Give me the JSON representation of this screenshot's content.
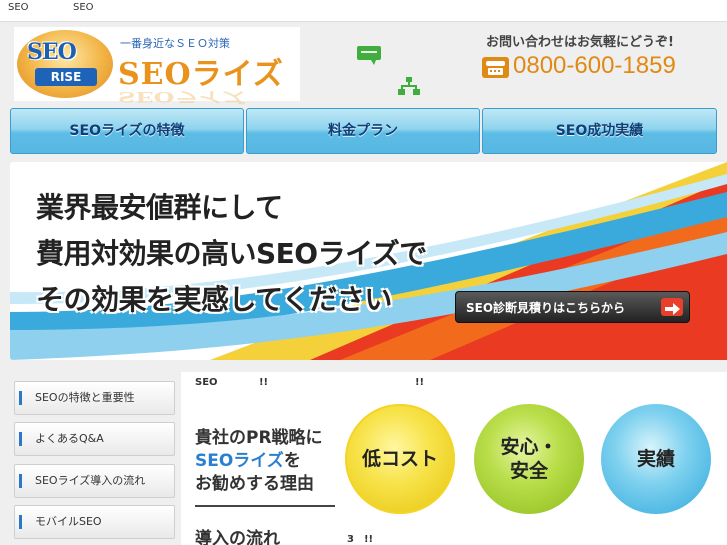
{
  "topbar": {
    "left_text": "SEO",
    "right_text": "SEO"
  },
  "logo": {
    "badge_top": "SEO",
    "badge_bottom": "RISE",
    "tagline": "一番身近なＳＥＯ対策",
    "name": "SEOライズ"
  },
  "contact": {
    "label": "お問い合わせはお気軽にどうぞ!",
    "phone": "0800-600-1859"
  },
  "nav": {
    "items": [
      {
        "label": "SEOライズの特徴"
      },
      {
        "label": "料金プラン"
      },
      {
        "label": "SEO成功実績"
      }
    ]
  },
  "hero": {
    "line1": "業界最安値群にして",
    "line2": "費用対効果の高いSEOライズで",
    "line3": "その効果を実感してください",
    "cta": "SEO診断見積りはこちらから"
  },
  "sidebar": {
    "items": [
      {
        "label": "SEOの特徴と重要性"
      },
      {
        "label": "よくあるQ&A"
      },
      {
        "label": "SEOライズ導入の流れ"
      },
      {
        "label": "モバイルSEO"
      }
    ]
  },
  "main": {
    "heading_part1": "SEO",
    "heading_part2": "!!",
    "heading_part3": "!!",
    "reason_line1": "貴社のPR戦略に",
    "reason_highlight": "SEOライズ",
    "reason_line2_suffix": "を",
    "reason_line3": "お勧めする理由",
    "circles": [
      {
        "label": "低コスト"
      },
      {
        "label": "安心・\n安全"
      },
      {
        "label": "実績"
      }
    ],
    "flow_heading": "導入の流れ",
    "flow_sub": "3　!!"
  },
  "colors": {
    "accent_orange": "#e9921c",
    "nav_blue": "#5dbde6",
    "cta_red": "#e8402a"
  }
}
